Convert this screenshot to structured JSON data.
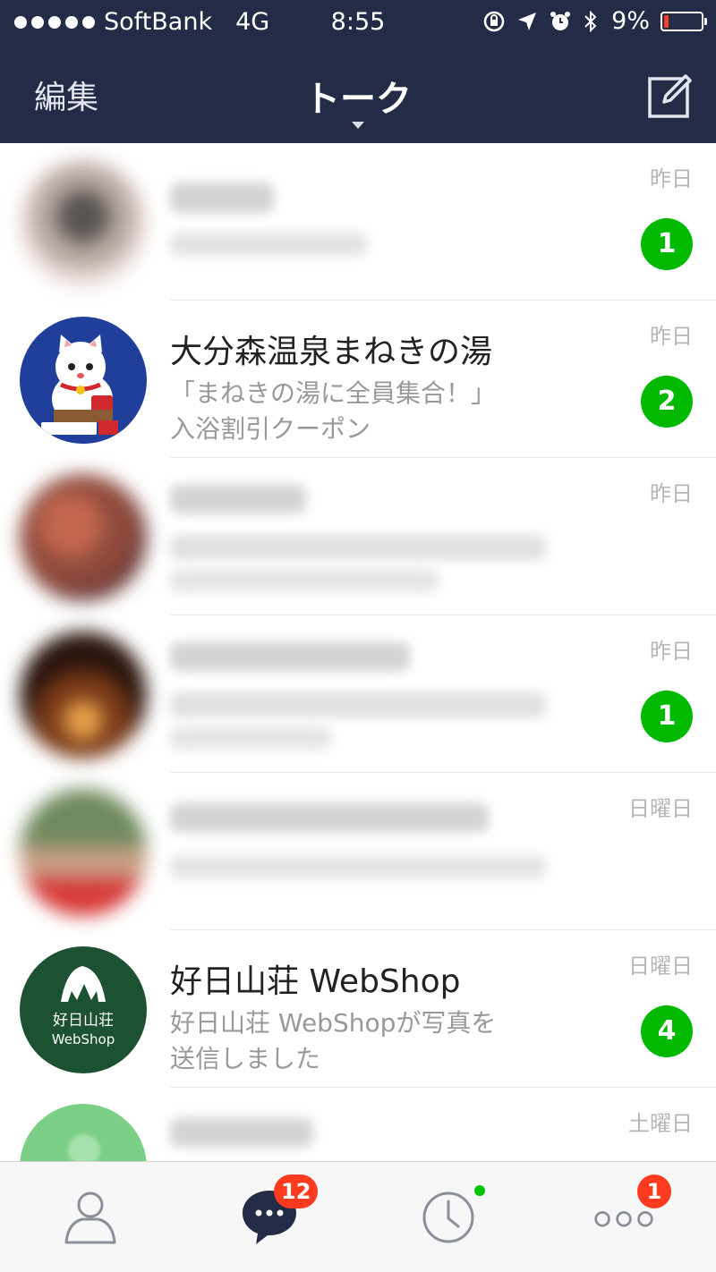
{
  "status_bar": {
    "carrier": "SoftBank",
    "network": "4G",
    "time": "8:55",
    "battery": "9%"
  },
  "nav": {
    "edit_label": "編集",
    "title": "トーク"
  },
  "chats": [
    {
      "name": "",
      "message_lines": [],
      "date": "昨日",
      "unread": "1"
    },
    {
      "name": "大分森温泉まねきの湯",
      "message_lines": [
        "「まねきの湯に全員集合！」",
        "入浴割引クーポン"
      ],
      "date": "昨日",
      "unread": "2"
    },
    {
      "name": "",
      "message_lines": [],
      "date": "昨日",
      "unread": ""
    },
    {
      "name": "",
      "message_lines": [],
      "date": "昨日",
      "unread": "1"
    },
    {
      "name": "",
      "message_lines": [],
      "date": "日曜日",
      "unread": ""
    },
    {
      "name": "好日山荘 WebShop",
      "message_lines": [
        "好日山荘 WebShopが写真を",
        "送信しました"
      ],
      "date": "日曜日",
      "unread": "4",
      "avatar_text": [
        "好日山荘",
        "WebShop"
      ]
    },
    {
      "name": "",
      "message_lines": [],
      "date": "土曜日",
      "unread": ""
    }
  ],
  "tab_bar": {
    "chats_badge": "12",
    "more_badge": "1"
  },
  "colors": {
    "header_bg": "#242b46",
    "unread_badge": "#00b900",
    "tab_badge": "#ff3b1f",
    "battery_low": "#ff3b30"
  }
}
